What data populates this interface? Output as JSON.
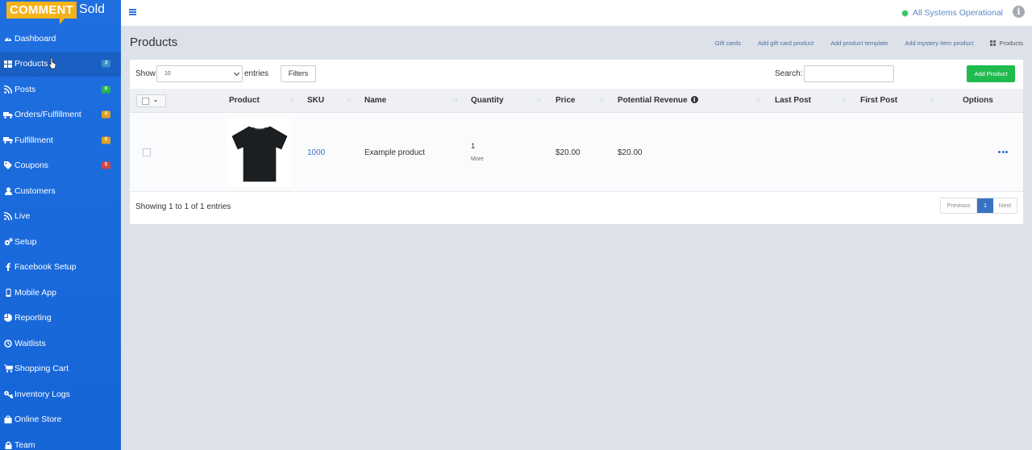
{
  "brand": {
    "comment": "COMMENT",
    "sold": "Sold"
  },
  "colors": {
    "sidebar": "#1565d8",
    "logo": "#f6b21a",
    "accent": "#3873c3",
    "add_button": "#1fbb4e",
    "status_dot": "#3cc26a"
  },
  "sidebar": {
    "items": [
      {
        "label": "Dashboard",
        "icon": "dashboard-icon"
      },
      {
        "label": "Products",
        "icon": "grid-icon",
        "badge": "3",
        "badge_color": "#3b8fc7",
        "active": true
      },
      {
        "label": "Posts",
        "icon": "rss-icon",
        "badge": "0",
        "badge_color": "#27b34f"
      },
      {
        "label": "Orders/Fulfillment",
        "icon": "truck-icon",
        "badge": "0",
        "badge_color": "#e0a020"
      },
      {
        "label": "Fulfillment",
        "icon": "truck-icon",
        "badge": "0",
        "badge_color": "#e0a020"
      },
      {
        "label": "Coupons",
        "icon": "tag-icon",
        "badge": "5",
        "badge_color": "#d64541"
      },
      {
        "label": "Customers",
        "icon": "user-icon"
      },
      {
        "label": "Live",
        "icon": "rss-icon"
      },
      {
        "label": "Setup",
        "icon": "gears-icon"
      },
      {
        "label": "Facebook Setup",
        "icon": "facebook-icon"
      },
      {
        "label": "Mobile App",
        "icon": "mobile-icon"
      },
      {
        "label": "Reporting",
        "icon": "pie-chart-icon"
      },
      {
        "label": "Waitlists",
        "icon": "clock-icon"
      },
      {
        "label": "Shopping Cart",
        "icon": "cart-icon"
      },
      {
        "label": "Inventory Logs",
        "icon": "key-icon"
      },
      {
        "label": "Online Store",
        "icon": "bag-icon"
      },
      {
        "label": "Team",
        "icon": "lock-icon"
      }
    ]
  },
  "topbar": {
    "status": "All Systems Operational"
  },
  "header": {
    "title": "Products",
    "actions": [
      "Gift cards",
      "Add gift card product",
      "Add product template",
      "Add mystery item product"
    ],
    "breadcrumb": "Products"
  },
  "controls": {
    "show": "Show",
    "entries_value": "10",
    "entries": "entries",
    "filters": "Filters",
    "search": "Search:",
    "search_value": "",
    "add_product": "Add Product"
  },
  "table": {
    "columns": [
      "Product",
      "SKU",
      "Name",
      "Quantity",
      "Price",
      "Potential Revenue",
      "Last Post",
      "First Post",
      "Options"
    ],
    "rows": [
      {
        "sku": "1000",
        "name": "Example product",
        "quantity": "1",
        "more": "More",
        "price": "$20.00",
        "potential_revenue": "$20.00",
        "last_post": "",
        "first_post": ""
      }
    ]
  },
  "footer": {
    "showing": "Showing 1 to 1 of 1 entries",
    "prev": "Previous",
    "page": "1",
    "next": "Next"
  }
}
